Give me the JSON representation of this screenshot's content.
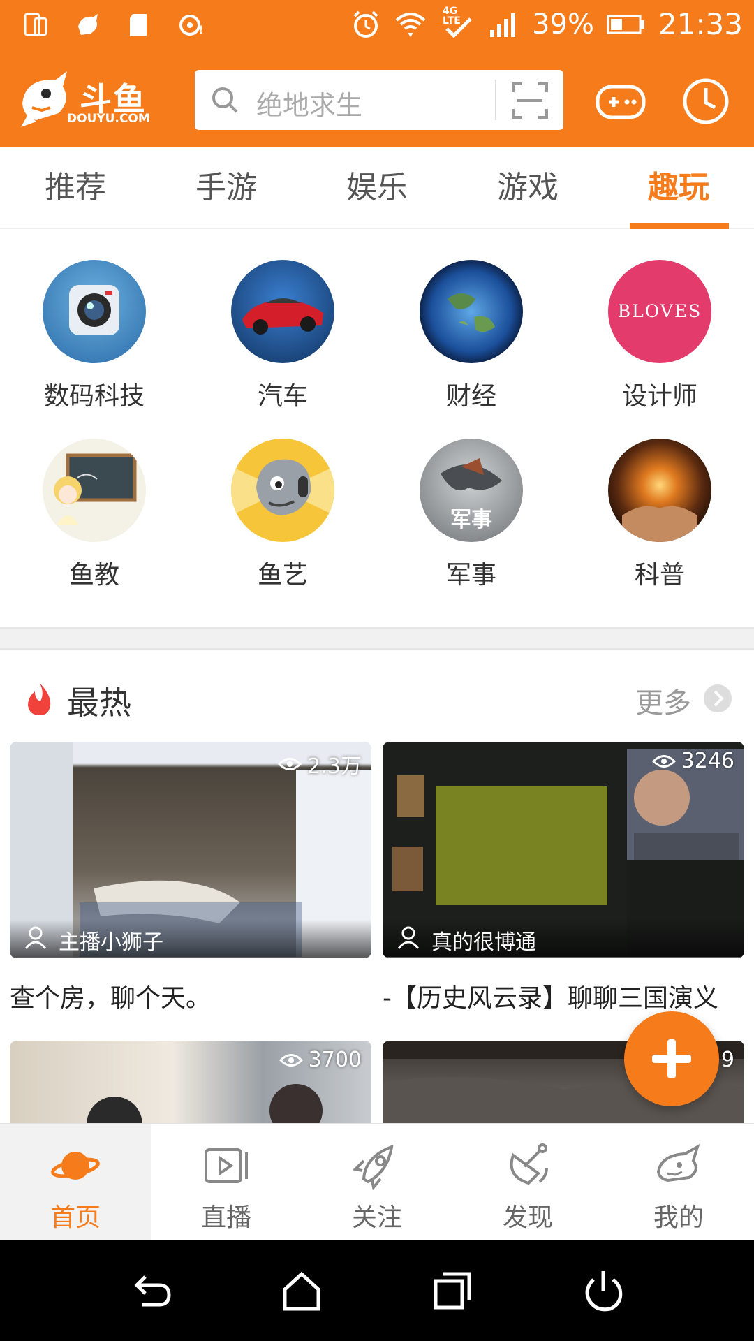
{
  "status_bar": {
    "network": "4G LTE",
    "battery": "39%",
    "time": "21:33"
  },
  "header": {
    "logo_name": "斗鱼",
    "logo_domain": "DOUYU.COM",
    "search_placeholder": "绝地求生"
  },
  "tabs": [
    {
      "label": "推荐"
    },
    {
      "label": "手游"
    },
    {
      "label": "娱乐"
    },
    {
      "label": "游戏"
    },
    {
      "label": "趣玩",
      "active": true
    }
  ],
  "categories": [
    {
      "label": "数码科技",
      "icon": "camera"
    },
    {
      "label": "汽车",
      "icon": "sports-car"
    },
    {
      "label": "财经",
      "icon": "earth"
    },
    {
      "label": "设计师",
      "icon": "bloves-logo",
      "icon_text": "BLOVES"
    },
    {
      "label": "鱼教",
      "icon": "chalkboard-girl"
    },
    {
      "label": "鱼艺",
      "icon": "shark-mascot"
    },
    {
      "label": "军事",
      "icon": "military",
      "icon_text": "军事"
    },
    {
      "label": "科普",
      "icon": "glowing-hands"
    }
  ],
  "hot": {
    "title": "最热",
    "more": "更多",
    "cards": [
      {
        "views": "2.3万",
        "anchor": "主播小狮子",
        "title": "查个房，聊个天。"
      },
      {
        "views": "3246",
        "anchor": "真的很博通",
        "title": "-【历史风云录】聊聊三国演义"
      },
      {
        "views": "3700",
        "anchor": "",
        "title": ""
      },
      {
        "views": "9",
        "anchor": "",
        "title": ""
      }
    ]
  },
  "bottom_nav": [
    {
      "label": "首页",
      "icon": "planet-icon",
      "active": true
    },
    {
      "label": "直播",
      "icon": "live-video-icon"
    },
    {
      "label": "关注",
      "icon": "rocket-icon"
    },
    {
      "label": "发现",
      "icon": "satellite-dish-icon"
    },
    {
      "label": "我的",
      "icon": "shark-head-icon"
    }
  ],
  "colors": {
    "brand": "#f67b1b",
    "text": "#333333",
    "muted": "#999999"
  }
}
